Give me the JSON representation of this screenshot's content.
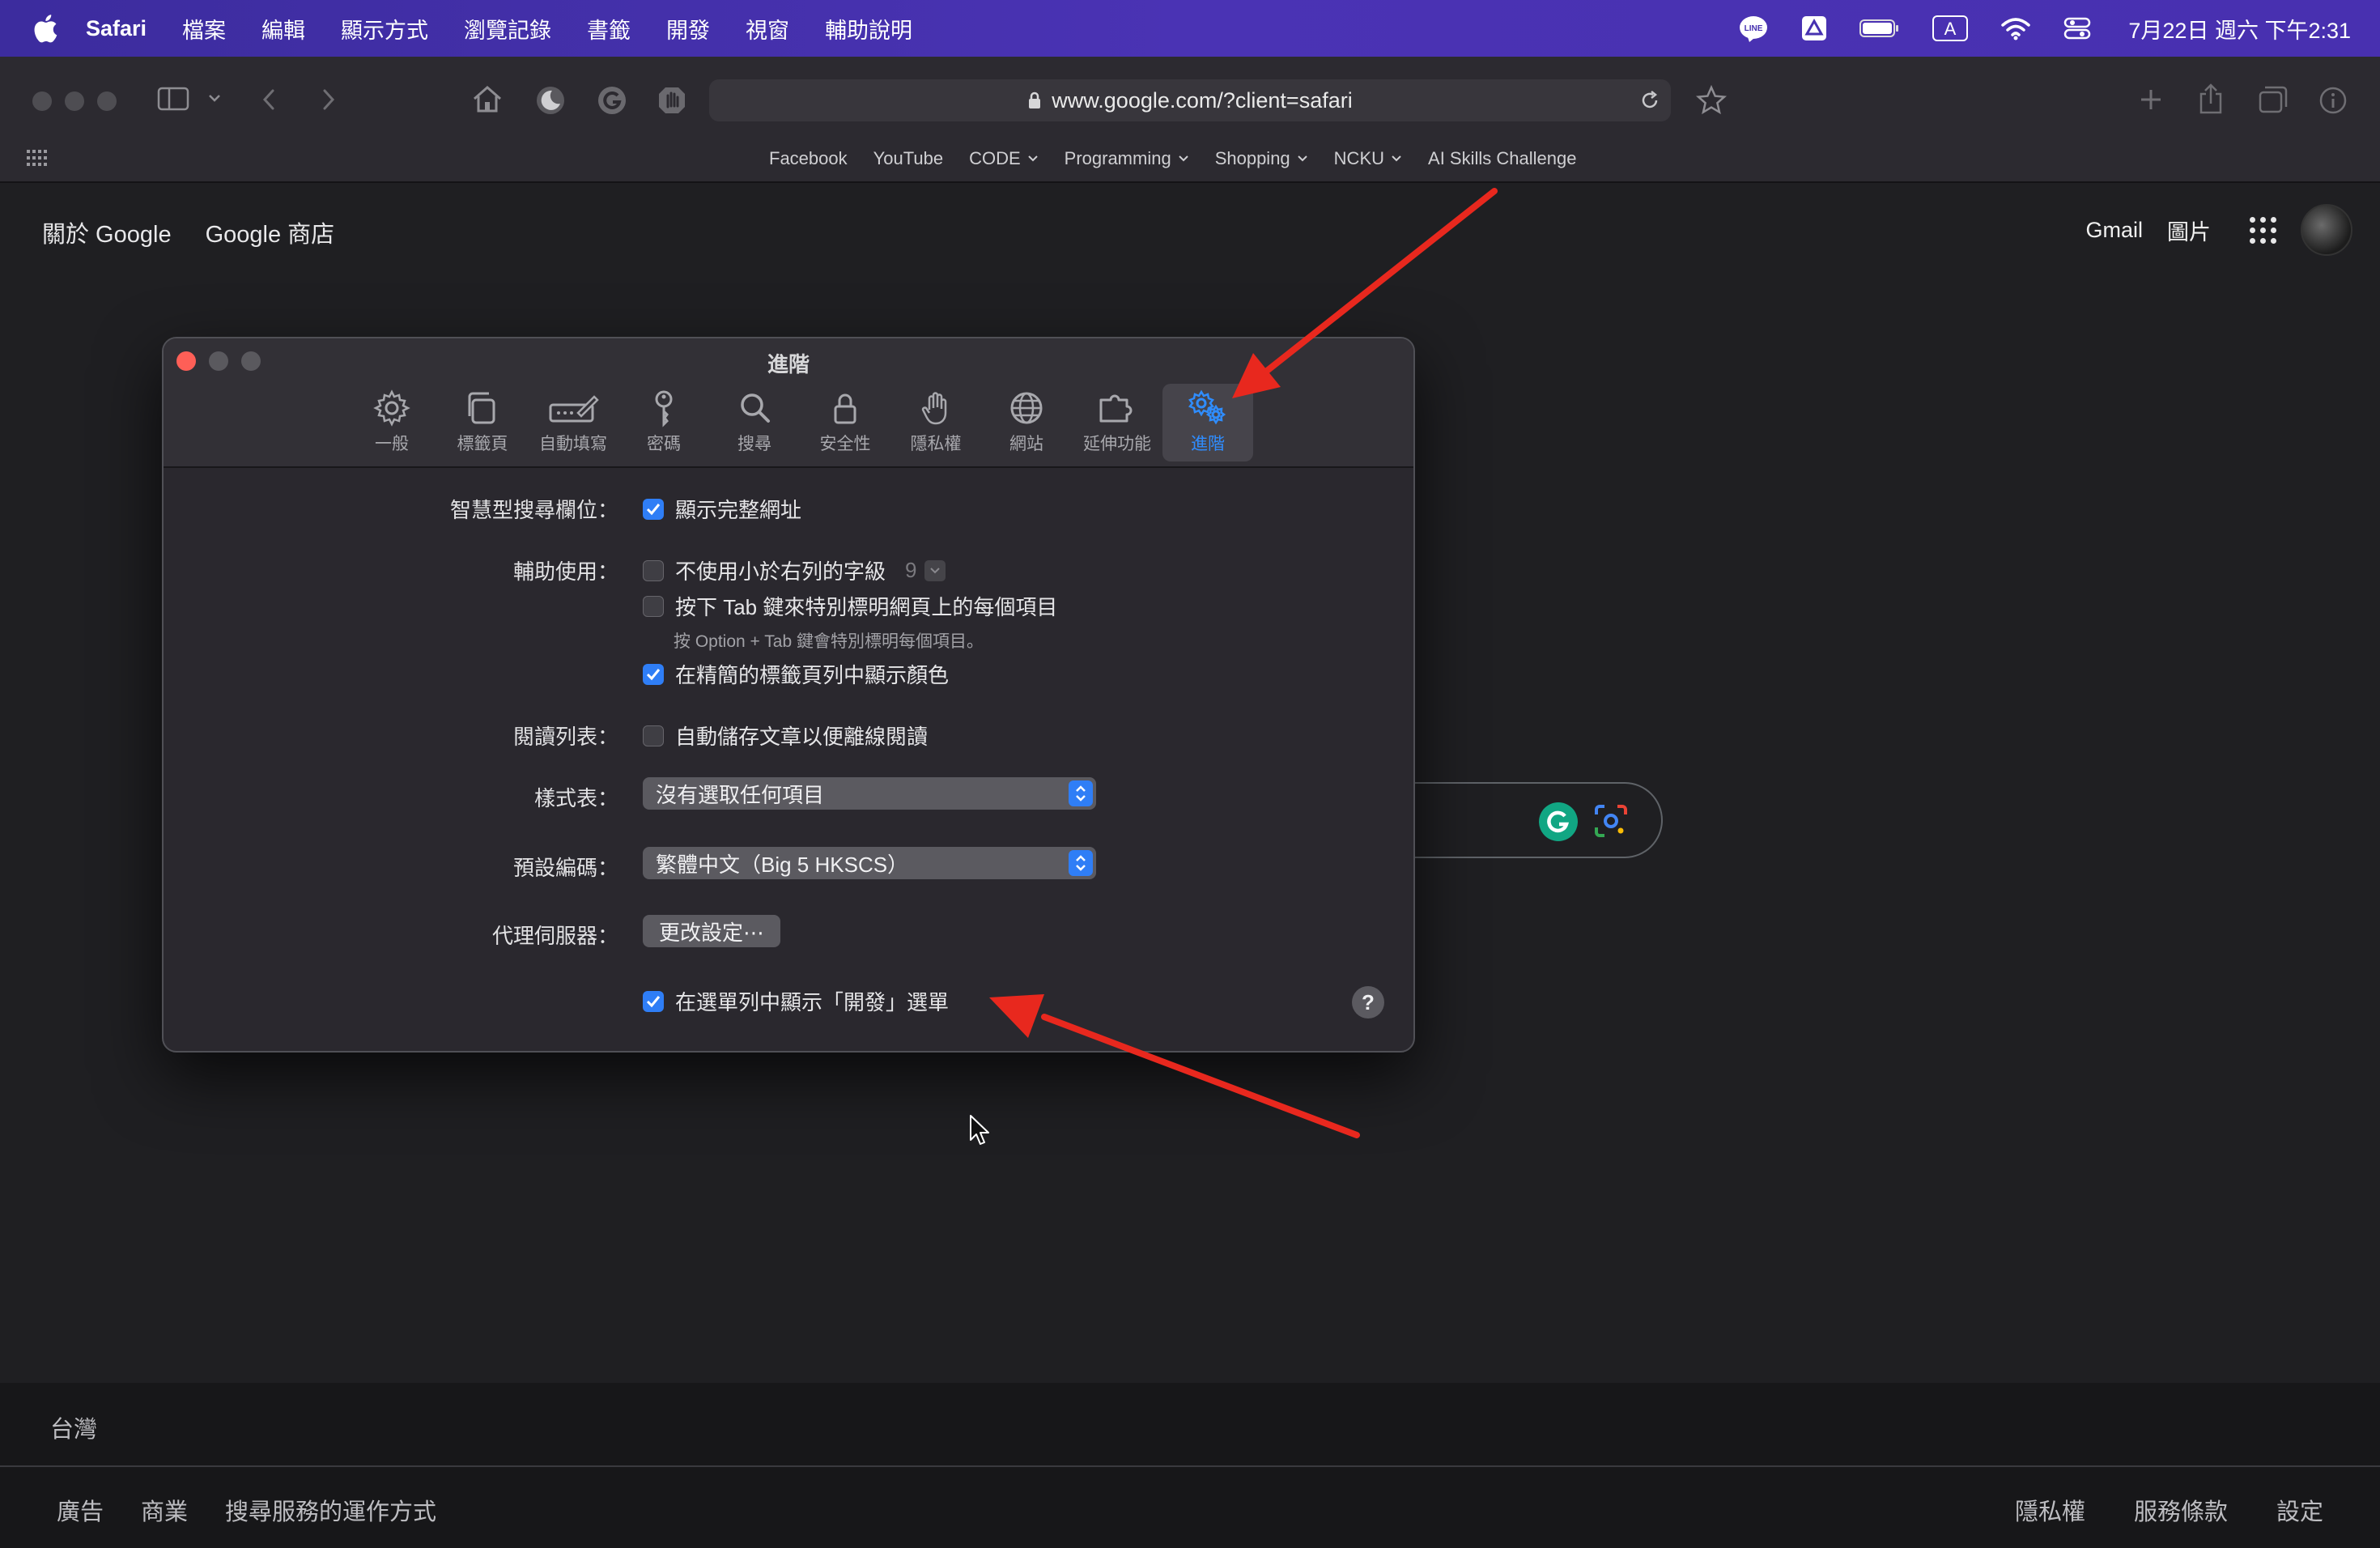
{
  "menubar": {
    "app": "Safari",
    "items": [
      "檔案",
      "編輯",
      "顯示方式",
      "瀏覽記錄",
      "書籤",
      "開發",
      "視窗",
      "輔助說明"
    ],
    "input_indicator": "A",
    "clock": "7月22日 週六 下午2:31",
    "icons": [
      "apple-icon",
      "line-icon",
      "drive-icon",
      "battery-icon",
      "wifi-icon",
      "control-center-icon"
    ]
  },
  "browser": {
    "url": "www.google.com/?client=safari",
    "favorites": [
      {
        "label": "Facebook",
        "menu": false
      },
      {
        "label": "YouTube",
        "menu": false
      },
      {
        "label": "CODE",
        "menu": true
      },
      {
        "label": "Programming",
        "menu": true
      },
      {
        "label": "Shopping",
        "menu": true
      },
      {
        "label": "NCKU",
        "menu": true
      },
      {
        "label": "AI Skills Challenge",
        "menu": false
      }
    ]
  },
  "google": {
    "top_left": [
      "關於 Google",
      "Google 商店"
    ],
    "gmail": "Gmail",
    "images": "圖片",
    "region": "台灣",
    "footer_left": [
      "廣告",
      "商業",
      "搜尋服務的運作方式"
    ],
    "footer_right": [
      "隱私權",
      "服務條款",
      "設定"
    ]
  },
  "prefs": {
    "title": "進階",
    "tabs": [
      "一般",
      "標籤頁",
      "自動填寫",
      "密碼",
      "搜尋",
      "安全性",
      "隱私權",
      "網站",
      "延伸功能",
      "進階"
    ],
    "active_tab": "進階",
    "smart_search_label": "智慧型搜尋欄位：",
    "show_full_url": "顯示完整網址",
    "accessibility_label": "輔助使用：",
    "min_font": "不使用小於右列的字級",
    "min_font_value": "9",
    "tab_highlight": "按下 Tab 鍵來特別標明網頁上的每個項目",
    "tab_hint": "按 Option + Tab 鍵會特別標明每個項目。",
    "compact_color": "在精簡的標籤頁列中顯示顏色",
    "reading_list_label": "閱讀列表：",
    "reading_list_offline": "自動儲存文章以便離線閱讀",
    "stylesheet_label": "樣式表：",
    "stylesheet_value": "沒有選取任何項目",
    "encoding_label": "預設編碼：",
    "encoding_value": "繁體中文（Big 5 HKSCS）",
    "proxy_label": "代理伺服器：",
    "proxy_button": "更改設定⋯",
    "develop_menu": "在選單列中顯示「開發」選單",
    "help": "?",
    "checkbox_states": {
      "show_full_url": true,
      "min_font": false,
      "tab_highlight": false,
      "compact_color": true,
      "reading_list_offline": false,
      "develop_menu": true
    }
  },
  "colors": {
    "accent": "#2f7ef6",
    "annotation_arrow": "#e8281e",
    "close_button": "#fe5f57"
  }
}
